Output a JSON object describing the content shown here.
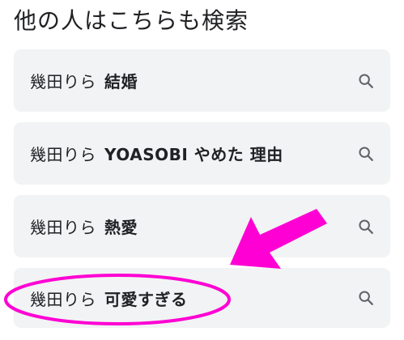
{
  "section": {
    "title": "他の人はこちらも検索"
  },
  "suggestions": [
    {
      "base": "幾田りら",
      "extra": "結婚"
    },
    {
      "base": "幾田りら",
      "extra": "YOASOBI やめた 理由"
    },
    {
      "base": "幾田りら",
      "extra": "熱愛"
    },
    {
      "base": "幾田りら",
      "extra": "可愛すぎる"
    }
  ],
  "icons": {
    "search": "search-icon",
    "annotation_arrow": "arrow-icon",
    "annotation_highlight": "highlight-ellipse"
  },
  "colors": {
    "card_background": "#f1f3f4",
    "text": "#202124",
    "icon": "#5f6368",
    "annotation": "#ff00d4"
  }
}
